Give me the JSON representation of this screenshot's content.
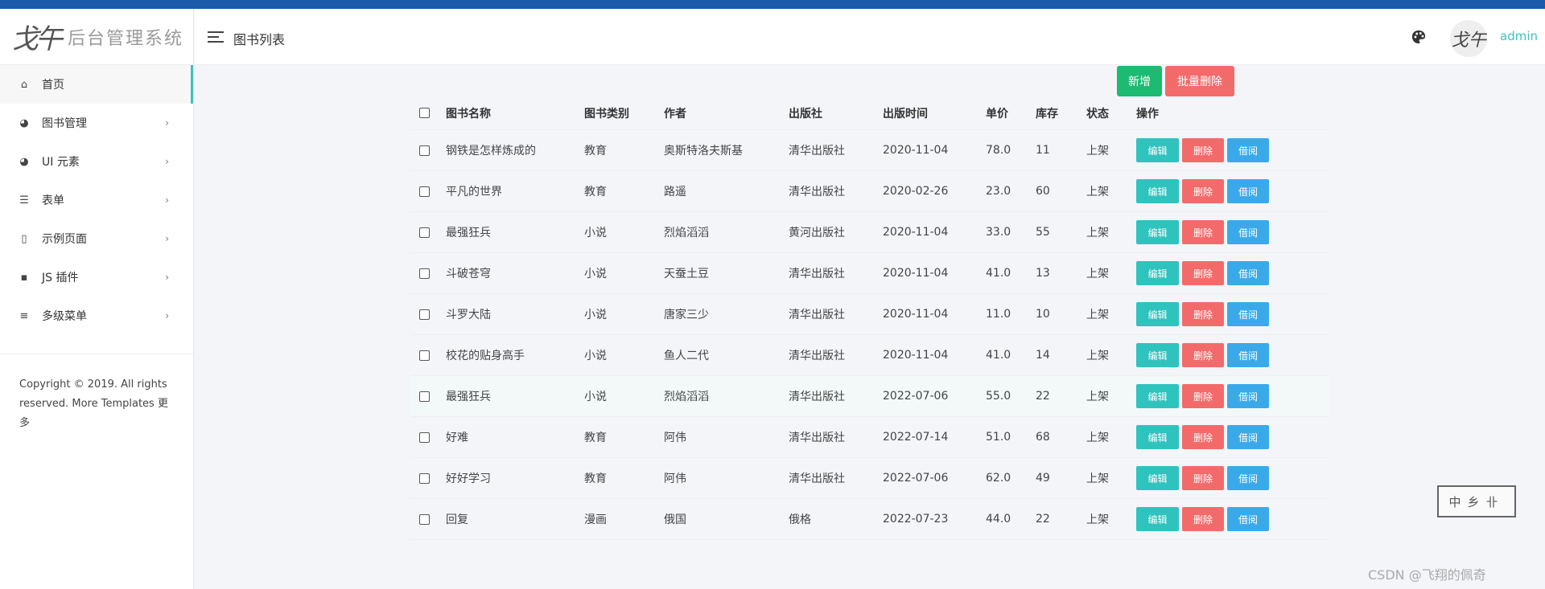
{
  "sidebar": {
    "logo_mark": "戈午",
    "logo_text": "后台管理系统",
    "items": [
      {
        "label": "首页",
        "icon": "home-icon",
        "has_arrow": false
      },
      {
        "label": "图书管理",
        "icon": "palette-icon",
        "has_arrow": true
      },
      {
        "label": "UI 元素",
        "icon": "palette-icon",
        "has_arrow": true
      },
      {
        "label": "表单",
        "icon": "list-icon",
        "has_arrow": true
      },
      {
        "label": "示例页面",
        "icon": "file-icon",
        "has_arrow": true
      },
      {
        "label": "JS 插件",
        "icon": "js-icon",
        "has_arrow": true
      },
      {
        "label": "多级菜单",
        "icon": "menu-icon",
        "has_arrow": true
      }
    ],
    "arrow": "›",
    "copyright": "Copyright © 2019. All rights reserved. More Templates 更多"
  },
  "header": {
    "title": "图书列表",
    "avatar_text": "戈午",
    "username": "admin"
  },
  "toolbar": {
    "add_label": "新增",
    "batch_delete_label": "批量删除"
  },
  "table": {
    "columns": [
      "图书名称",
      "图书类别",
      "作者",
      "出版社",
      "出版时间",
      "单价",
      "库存",
      "状态",
      "操作"
    ],
    "action_labels": {
      "edit": "编辑",
      "delete": "删除",
      "borrow": "借阅"
    },
    "rows": [
      {
        "name": "钢铁是怎样炼成的",
        "category": "教育",
        "author": "奥斯特洛夫斯基",
        "publisher": "清华出版社",
        "date": "2020-11-04",
        "price": "78.0",
        "stock": "11",
        "status": "上架"
      },
      {
        "name": "平凡的世界",
        "category": "教育",
        "author": "路遥",
        "publisher": "清华出版社",
        "date": "2020-02-26",
        "price": "23.0",
        "stock": "60",
        "status": "上架"
      },
      {
        "name": "最强狂兵",
        "category": "小说",
        "author": "烈焰滔滔",
        "publisher": "黄河出版社",
        "date": "2020-11-04",
        "price": "33.0",
        "stock": "55",
        "status": "上架"
      },
      {
        "name": "斗破苍穹",
        "category": "小说",
        "author": "天蚕土豆",
        "publisher": "清华出版社",
        "date": "2020-11-04",
        "price": "41.0",
        "stock": "13",
        "status": "上架"
      },
      {
        "name": "斗罗大陆",
        "category": "小说",
        "author": "唐家三少",
        "publisher": "清华出版社",
        "date": "2020-11-04",
        "price": "11.0",
        "stock": "10",
        "status": "上架"
      },
      {
        "name": "校花的贴身高手",
        "category": "小说",
        "author": "鱼人二代",
        "publisher": "清华出版社",
        "date": "2020-11-04",
        "price": "41.0",
        "stock": "14",
        "status": "上架"
      },
      {
        "name": "最强狂兵",
        "category": "小说",
        "author": "烈焰滔滔",
        "publisher": "清华出版社",
        "date": "2022-07-06",
        "price": "55.0",
        "stock": "22",
        "status": "上架"
      },
      {
        "name": "好难",
        "category": "教育",
        "author": "阿伟",
        "publisher": "清华出版社",
        "date": "2022-07-14",
        "price": "51.0",
        "stock": "68",
        "status": "上架"
      },
      {
        "name": "好好学习",
        "category": "教育",
        "author": "阿伟",
        "publisher": "清华出版社",
        "date": "2022-07-06",
        "price": "62.0",
        "stock": "49",
        "status": "上架"
      },
      {
        "name": "回复",
        "category": "漫画",
        "author": "俄国",
        "publisher": "俄格",
        "date": "2022-07-23",
        "price": "44.0",
        "stock": "22",
        "status": "上架"
      }
    ],
    "highlight_row": 6
  },
  "stamp": "中乡卝",
  "watermark": "CSDN @飞翔的佩奇",
  "colors": {
    "accent": "#38c4bf",
    "top_strip": "#1b5aa8",
    "add": "#1dba72",
    "danger": "#f36a6a",
    "borrow": "#3aa9ea"
  }
}
